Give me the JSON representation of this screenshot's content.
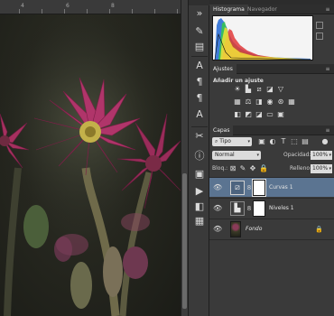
{
  "ruler": {
    "marks": [
      "4",
      "6",
      "8"
    ]
  },
  "tools": [
    "swap-arrows-icon",
    "brush-settings-icon",
    "brush-panel-icon",
    "clone-source-icon",
    "character-icon",
    "paragraph-icon",
    "paragraph-styles-icon",
    "character-styles-icon",
    "tool-presets-icon",
    "info-icon",
    "properties-icon",
    "actions-icon",
    "navigator-icon",
    "swatches-icon"
  ],
  "panels": {
    "top_tabs": [
      "Histograma",
      "Navegador"
    ],
    "adjust_tab": "Ajustes",
    "adjust_title": "Añadir un ajuste",
    "layers_tab": "Capas",
    "filter_kind": "Tipo",
    "blend_mode": "Normal",
    "opacity_label": "Opacidad:",
    "opacity_value": "100%",
    "lock_label": "Bloq.:",
    "fill_label": "Relleno:",
    "fill_value": "100%",
    "layers": [
      {
        "name": "Curvas 1",
        "type": "adjustment",
        "selected": true
      },
      {
        "name": "Niveles 1",
        "type": "adjustment",
        "selected": false
      },
      {
        "name": "Fondo",
        "type": "background",
        "selected": false
      }
    ]
  },
  "colors": {
    "selected_layer": "#5b7491",
    "panel_bg": "#3a3a3a",
    "canvas_bg": "#26271f"
  }
}
